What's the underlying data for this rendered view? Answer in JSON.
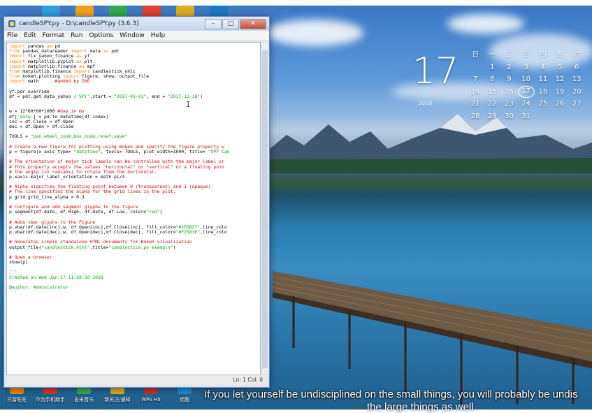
{
  "window": {
    "title": "candleSPY.py - D:\\candleSPY.py (3.6.3)",
    "min_label": "–",
    "max_label": "□",
    "close_label": "✕",
    "menus": [
      "File",
      "Edit",
      "Format",
      "Run",
      "Options",
      "Window",
      "Help"
    ],
    "status": "Ln: 1   Col: 0"
  },
  "code_lines": [
    [
      [
        "import",
        "kw"
      ],
      [
        " pandas ",
        "df"
      ],
      [
        "as",
        "kw"
      ],
      [
        " pd",
        "df"
      ]
    ],
    [
      [
        "from",
        "kw"
      ],
      [
        " pandas_datareader ",
        "df"
      ],
      [
        "import",
        "kw"
      ],
      [
        " data ",
        "df"
      ],
      [
        "as",
        "kw"
      ],
      [
        " pdr",
        "df"
      ]
    ],
    [
      [
        "import",
        "kw"
      ],
      [
        " fix_yahoo_finance ",
        "df"
      ],
      [
        "as",
        "kw"
      ],
      [
        " yf",
        "df"
      ]
    ],
    [
      [
        "import",
        "kw"
      ],
      [
        " matplotlib.pyplot ",
        "df"
      ],
      [
        "as",
        "kw"
      ],
      [
        " plt",
        "df"
      ]
    ],
    [
      [
        "import",
        "kw"
      ],
      [
        " matplotlib.finance ",
        "df"
      ],
      [
        "as",
        "kw"
      ],
      [
        " mpf",
        "df"
      ]
    ],
    [
      [
        "from",
        "kw"
      ],
      [
        " matplotlib.finance ",
        "df"
      ],
      [
        "import",
        "kw"
      ],
      [
        " candlestick_ohlc",
        "df"
      ]
    ],
    [
      [
        "from",
        "kw"
      ],
      [
        " bokeh.plotting ",
        "df"
      ],
      [
        "import",
        "kw"
      ],
      [
        " figure, show, output_file",
        "df"
      ]
    ],
    [
      [
        "import",
        "kw"
      ],
      [
        " math      ",
        "df"
      ],
      [
        "#added by ZHG",
        "cm"
      ]
    ],
    [
      [
        "",
        ""
      ]
    ],
    [
      [
        "yf.pdr_override",
        "df"
      ]
    ],
    [
      [
        "df = pdr.get_data_yahoo (",
        "df"
      ],
      [
        "'SPY'",
        "st"
      ],
      [
        ",start = ",
        "df"
      ],
      [
        "\"2017-01-01\"",
        "st"
      ],
      [
        ", end = ",
        "df"
      ],
      [
        "\"2017-12-18\"",
        "st"
      ],
      [
        ")",
        "df"
      ]
    ],
    [
      [
        "",
        ""
      ]
    ],
    [
      [
        "",
        ""
      ]
    ],
    [
      [
        "w = 12*60*60*1000 ",
        "df"
      ],
      [
        "#day in ms",
        "cm"
      ]
    ],
    [
      [
        "df[",
        "df"
      ],
      [
        "'date'",
        "st"
      ],
      [
        "] = pd.to_datetime(df.index)",
        "df"
      ]
    ],
    [
      [
        "inc = df.Close > df.Open",
        "df"
      ]
    ],
    [
      [
        "dec = df.Open > df.Close",
        "df"
      ]
    ],
    [
      [
        "",
        ""
      ]
    ],
    [
      [
        "TOOLS = ",
        "df"
      ],
      [
        "\"pan,wheel_zoom,box_zoom,reset,save\"",
        "st"
      ]
    ],
    [
      [
        "",
        ""
      ]
    ],
    [
      [
        "# Create a new figure for plotting using Bokeh and specify the figure property w",
        "cm"
      ]
    ],
    [
      [
        "p = figure(x_axis_type= ",
        "df"
      ],
      [
        "\"datetime\"",
        "st"
      ],
      [
        ", tools= TOOLS, plot_width=1000, title= ",
        "df"
      ],
      [
        "\"SPY Can",
        "st"
      ]
    ],
    [
      [
        "",
        ""
      ]
    ],
    [
      [
        "# The orientation of major tick labels can be controlled with the major_label_or",
        "cm"
      ]
    ],
    [
      [
        "# This property accepts the values \"horizontal\" or \"vertical\" or a floating poin",
        "cm"
      ]
    ],
    [
      [
        "# the angle (in radians) to rotate from the horizontal.",
        "cm"
      ]
    ],
    [
      [
        "p.xaxis.major_label_orientation = math.pi/4",
        "df"
      ]
    ],
    [
      [
        "",
        ""
      ]
    ],
    [
      [
        "# Alpha signifies the floating point between 0 (transparent) and 1 (opaque).",
        "cm"
      ]
    ],
    [
      [
        "# The line specifies the alpha for the grid lines in the plot.",
        "cm"
      ]
    ],
    [
      [
        "p.grid.grid_line_alpha = 0.3",
        "df"
      ]
    ],
    [
      [
        "",
        ""
      ]
    ],
    [
      [
        "# Configure and add segment glyphs to the figure",
        "cm"
      ]
    ],
    [
      [
        "p.segment(df.date, df.High, df.date, df.Low, color=",
        "df"
      ],
      [
        "\"red\"",
        "st"
      ],
      [
        ")",
        "df"
      ]
    ],
    [
      [
        "",
        ""
      ]
    ],
    [
      [
        "# Adds vbar glyphs to the Figure",
        "cm"
      ]
    ],
    [
      [
        "p.vbar(df.date[inc],w, df.Open[inc],df.Close[inc], fill_color=",
        "df"
      ],
      [
        "\"#1ED837\"",
        "st"
      ],
      [
        ",line_colo",
        "df"
      ]
    ],
    [
      [
        "p.vbar(df.date[dec],w, df.Open[dec],df.Close[dec], fill_color=",
        "df"
      ],
      [
        "\"#F2583E\"",
        "st"
      ],
      [
        ",line_colo",
        "df"
      ]
    ],
    [
      [
        "",
        ""
      ]
    ],
    [
      [
        "# Generates simple standalone HTML documents for Bokeh visualization",
        "cm"
      ]
    ],
    [
      [
        "output_file(",
        "df"
      ],
      [
        "\"candlestick.html\"",
        "st"
      ],
      [
        ",title=",
        "df"
      ],
      [
        "\"candlestick.py example\"",
        "st"
      ],
      [
        ")",
        "df"
      ]
    ],
    [
      [
        "",
        ""
      ]
    ],
    [
      [
        "# Open a browser",
        "cm"
      ]
    ],
    [
      [
        "show(p)",
        "df"
      ]
    ],
    [
      [
        "",
        ""
      ]
    ],
    [
      [
        "'''",
        "st"
      ]
    ],
    [
      [
        "Created on Wed Jan 17 11:39:50 2018",
        "st"
      ]
    ],
    [
      [
        "",
        ""
      ]
    ],
    [
      [
        "@author: Administrator",
        "st"
      ]
    ],
    [
      [
        "'''",
        "st"
      ]
    ]
  ],
  "calendar": {
    "big_date": "17",
    "note": "2018",
    "weekday_headers": [
      "日",
      "一",
      "二",
      "三",
      "四",
      "五",
      "六"
    ],
    "weeks": [
      [
        "",
        "1",
        "2",
        "3",
        "4",
        "5",
        "6"
      ],
      [
        "7",
        "8",
        "9",
        "10",
        "11",
        "12",
        "13"
      ],
      [
        "14",
        "15",
        "16",
        "17",
        "18",
        "19",
        "20"
      ],
      [
        "21",
        "22",
        "23",
        "24",
        "25",
        "26",
        "27"
      ],
      [
        "28",
        "29",
        "30",
        "31",
        "",
        "",
        ""
      ]
    ],
    "today": "17"
  },
  "desktop_icons": [
    {
      "label": "只留旺旺",
      "color": "#f08a00"
    },
    {
      "label": "华为手机助手",
      "color": "#d9372c"
    },
    {
      "label": "吉米音乐",
      "color": "#35b050"
    },
    {
      "label": "新关注/通知\n文件夹",
      "color": "#e6b020"
    },
    {
      "label": "WPS H5",
      "color": "#c9332a"
    },
    {
      "label": "优酷",
      "color": "#1f8fe0"
    }
  ],
  "top_icon_colors": [
    "#2e9fe0",
    "#f0a020",
    "#34a853",
    "#e04030",
    "#d9b020",
    "#1d77c9"
  ],
  "subtitle_line1": "If you let yourself be undisciplined on the small things, you will probably be undis",
  "subtitle_line2": "the large things as well."
}
